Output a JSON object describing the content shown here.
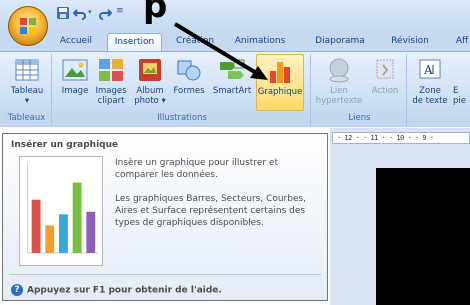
{
  "top_text": "p",
  "tabs": [
    {
      "label": "Accueil"
    },
    {
      "label": "Insertion"
    },
    {
      "label": "Création"
    },
    {
      "label": "Animations"
    },
    {
      "label": "Diaporama"
    },
    {
      "label": "Révision"
    },
    {
      "label": "Aff"
    }
  ],
  "ribbon": {
    "groups": {
      "tableaux": "Tableaux",
      "illustrations": "Illustrations",
      "liens": "Liens"
    },
    "buttons": {
      "tableau": "Tableau",
      "image": "Image",
      "images_clipart_1": "Images",
      "images_clipart_2": "clipart",
      "album_1": "Album",
      "album_2": "photo",
      "formes": "Formes",
      "smartart": "SmartArt",
      "graphique": "Graphique",
      "lien_1": "Lien",
      "lien_2": "hypertexte",
      "action": "Action",
      "zone_1": "Zone",
      "zone_2": "de texte",
      "e_1": "E",
      "e_2": "pie"
    }
  },
  "tooltip": {
    "title": "Insérer un graphique",
    "description_1": "Insère un graphique pour illustrer et comparer les données.",
    "description_2": "Les graphiques Barres, Secteurs, Courbes, Aires et Surface représentent certains des types de graphiques disponibles.",
    "help": "Appuyez sur F1 pour obtenir de l'aide.",
    "chart_colors": [
      "#d9534f",
      "#f0a030",
      "#3aa6d8",
      "#74c043",
      "#8a5fb5"
    ],
    "chart_levels": [
      0.62,
      0.32,
      0.45,
      0.82,
      0.48
    ]
  },
  "ruler_text": "· 12 · · 11 · · 10 · · 9 ·",
  "colors": {
    "ribbon_blue": "#c6d9f1",
    "text_blue": "#15428b",
    "highlight": "#ffd96b"
  }
}
